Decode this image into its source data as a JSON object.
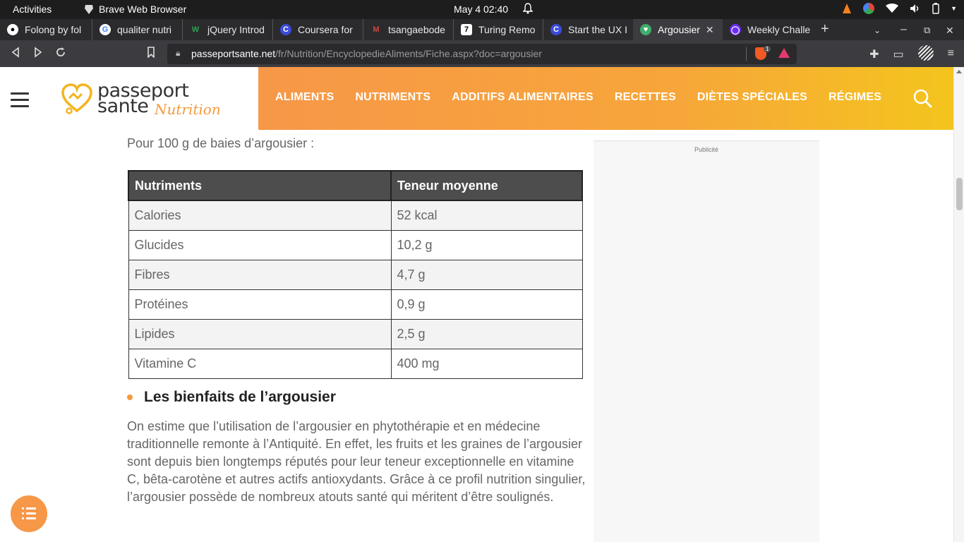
{
  "system": {
    "activities": "Activities",
    "app_name": "Brave Web Browser",
    "clock": "May 4  02:40"
  },
  "tabs": [
    {
      "label": "Folong by fol",
      "icon_color": "#ffffff",
      "icon": "github-icon"
    },
    {
      "label": "qualiter nutri",
      "icon_color": "#4285f4",
      "icon": "google-icon"
    },
    {
      "label": "jQuery Introd",
      "icon_color": "#2ea44f",
      "icon": "w-icon"
    },
    {
      "label": "Coursera for",
      "icon_color": "#3b4bd8",
      "icon": "coursera-icon"
    },
    {
      "label": "tsangaebode",
      "icon_color": "#d44638",
      "icon": "gmail-icon"
    },
    {
      "label": "Turing Remo",
      "icon_color": "#111111",
      "icon": "turing-icon"
    },
    {
      "label": "Start the UX I",
      "icon_color": "#3b4bd8",
      "icon": "coursera-icon"
    },
    {
      "label": "Argousier",
      "icon_color": "#3fae6a",
      "icon": "passeport-icon",
      "active": true
    },
    {
      "label": "Weekly Challe",
      "icon_color": "#6b2ef5",
      "icon": "q-icon"
    }
  ],
  "urlbar": {
    "domain": "passeportsante.net",
    "path": "/fr/Nutrition/EncyclopedieAliments/Fiche.aspx?doc=argousier",
    "shield_count": "1"
  },
  "site": {
    "logo_line1": "passeport",
    "logo_line2": "sante",
    "logo_sub": "Nutrition",
    "menu": [
      "ALIMENTS",
      "NUTRIMENTS",
      "ADDITIFS ALIMENTAIRES",
      "RECETTES",
      "DIÈTES SPÉCIALES",
      "RÉGIMES"
    ],
    "brand_color": "#f79748"
  },
  "content": {
    "intro": "Pour 100 g de baies d’argousier :",
    "table": {
      "headers": [
        "Nutriments",
        "Teneur moyenne"
      ],
      "rows": [
        [
          "Calories",
          "52 kcal"
        ],
        [
          "Glucides",
          "10,2 g"
        ],
        [
          "Fibres",
          "4,7 g"
        ],
        [
          "Protéines",
          "0,9 g"
        ],
        [
          "Lipides",
          "2,5 g"
        ],
        [
          "Vitamine C",
          "400 mg"
        ]
      ]
    },
    "heading": "Les bienfaits de l’argousier",
    "paragraph": "On estime que l’utilisation de l’argousier en phytothérapie et en médecine traditionnelle remonte à l’Antiquité. En effet, les fruits et les graines de l’argousier sont depuis bien longtemps réputés pour leur teneur exceptionnelle en vitamine C, bêta-carotène et autres actifs antioxydants. Grâce à ce profil nutrition singulier, l’argousier possède de nombreux atouts santé qui méritent d’être soulignés.",
    "ad_label": "Publicité"
  }
}
